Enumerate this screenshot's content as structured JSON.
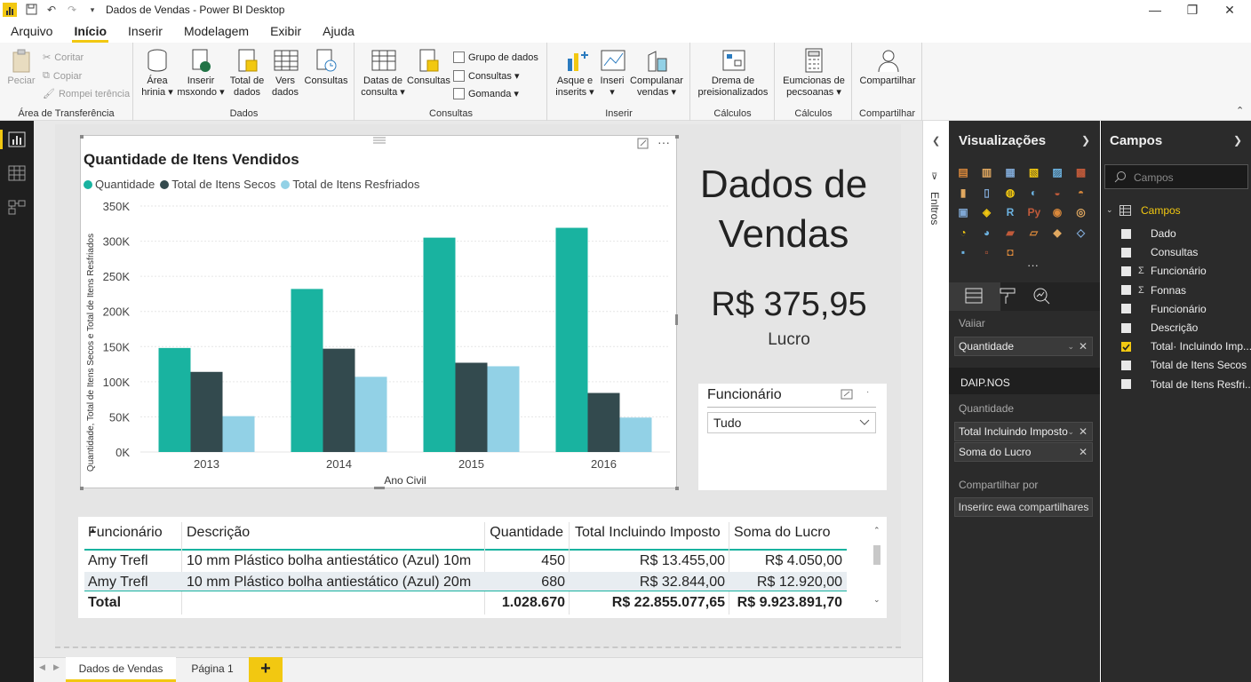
{
  "window": {
    "title": "Dados de Vendas - Power BI Desktop"
  },
  "menu": {
    "tabs": [
      "Arquivo",
      "Início",
      "Inserir",
      "Modelagem",
      "Exibir",
      "Ajuda"
    ]
  },
  "ribbon": {
    "clipboard": {
      "paste": "Peciar",
      "cut": "Coritar",
      "copy": "Copiar",
      "format_painter": "Rompei terência",
      "label": "Área de Transferência"
    },
    "data": {
      "buttons": [
        {
          "line1": "Área",
          "line2": "hrinia ▾"
        },
        {
          "line1": "Inserir",
          "line2": "msxondo ▾"
        },
        {
          "line1": "Total de",
          "line2": "dados"
        },
        {
          "line1": "Vers",
          "line2": "dados"
        },
        {
          "line1": "Consultas",
          "line2": ""
        }
      ],
      "label": "Dados"
    },
    "queries": {
      "btn1_l1": "Datas de",
      "btn1_l2": "consulta ▾",
      "btn2": "Consultas",
      "small1": "Grupo de dados",
      "small2": "Consultas ▾",
      "small3": "Gomanda ▾",
      "label": "Consultas"
    },
    "insert": {
      "btn1_l1": "Asque e",
      "btn1_l2": "inserits ▾",
      "btn2_l1": "Inseri",
      "btn2_l2": "▾",
      "btn3_l1": "Compulanar",
      "btn3_l2": "vendas ▾",
      "label": "Inserir"
    },
    "calc1": {
      "btn_l1": "Drema de",
      "btn_l2": "preisionalizados",
      "label": "Cálculos"
    },
    "calc2": {
      "btn_l1": "Eumcionas de",
      "btn_l2": "pecsoanas ▾",
      "label": "Cálculos"
    },
    "share": {
      "btn": "Compartilhar",
      "label": "Compartilhar"
    }
  },
  "report": {
    "big_title": "Dados de Vendas",
    "kpi": {
      "value": "R$ 375,95",
      "label": "Lucro"
    },
    "slicer": {
      "title": "Funcionário",
      "value": "Tudo"
    }
  },
  "chart_data": {
    "type": "bar",
    "title": "Quantidade de Itens Vendidos",
    "xlabel": "Ano Civil",
    "ylabel": "Quantidade, Total de Itens Secos e Total de Itens Resfriados",
    "categories": [
      "2013",
      "2014",
      "2015",
      "2016"
    ],
    "series": [
      {
        "name": "Quantidade",
        "values": [
          148000,
          232000,
          305000,
          319000
        ],
        "color": "#19b3a0"
      },
      {
        "name": "Total de Itens Secos",
        "values": [
          114000,
          147000,
          127000,
          84000
        ],
        "color": "#334a4e"
      },
      {
        "name": "Total de Itens Resfriados",
        "values": [
          51000,
          107000,
          122000,
          49000
        ],
        "color": "#92d1e6"
      }
    ],
    "ylim": [
      0,
      350000
    ],
    "yticks": [
      "0K",
      "50K",
      "100K",
      "150K",
      "200K",
      "250K",
      "300K",
      "350K"
    ],
    "legend": "top-left",
    "grid": true
  },
  "table": {
    "headers": [
      "Funcionário",
      "Descrição",
      "Quantidade",
      "Total Incluindo Imposto",
      "Soma do Lucro"
    ],
    "rows": [
      [
        "Amy Trefl",
        "10 mm Plástico bolha antiestático (Azul) 10m",
        "450",
        "R$ 13.455,00",
        "R$ 4.050,00"
      ],
      [
        "Amy Trefl",
        "10 mm Plástico bolha antiestático (Azul) 20m",
        "680",
        "R$ 32.844,00",
        "R$ 12.920,00"
      ]
    ],
    "total": [
      "Total",
      "",
      "1.028.670",
      "R$ 22.855.077,65",
      "R$ 9.923.891,70"
    ]
  },
  "pages": {
    "tabs": [
      "Dados de Vendas",
      "Página 1"
    ],
    "add": "+"
  },
  "filters": {
    "label": "Enltros"
  },
  "viz_pane": {
    "title": "Visualizações",
    "more": "···",
    "values_section": "Vaiiar",
    "value_well": "Quantidade",
    "details_header": "DAIP.NOS",
    "details_section": "Quantidade",
    "tooltip_wells": [
      "Total Incluindo Imposto",
      "Soma do Lucro"
    ],
    "drill_section": "Compartilhar por",
    "drill_button": "Inserirc ewa compartilhares"
  },
  "fields_pane": {
    "title": "Campos",
    "search_placeholder": "Campos",
    "table_name": "Campos",
    "items": [
      {
        "label": "Dado",
        "sigma": false,
        "checked": false
      },
      {
        "label": "Consultas",
        "sigma": false,
        "checked": false
      },
      {
        "label": "Funcionário",
        "sigma": true,
        "checked": false
      },
      {
        "label": "Fonnas",
        "sigma": true,
        "checked": false
      },
      {
        "label": "Funcionário",
        "sigma": false,
        "checked": false
      },
      {
        "label": "Descrição",
        "sigma": false,
        "checked": false
      },
      {
        "label": "Total· Incluindo Imp...",
        "sigma": false,
        "checked": true
      },
      {
        "label": "Total de Itens Secos",
        "sigma": false,
        "checked": false
      },
      {
        "label": "Total de Itens Resfri...",
        "sigma": false,
        "checked": false
      }
    ]
  }
}
